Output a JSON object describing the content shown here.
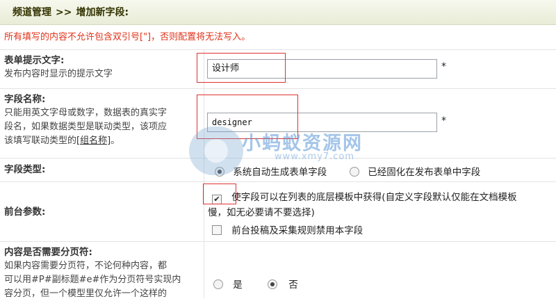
{
  "breadcrumb": {
    "section": "频道管理",
    "separator": ">>",
    "page": "增加新字段:"
  },
  "warning": "所有填写的内容不允许包含双引号[\"]，否则配置将无法写入。",
  "form": {
    "prompt_text": {
      "label": "表单提示文字:",
      "desc": "发布内容时显示的提示文字",
      "value": "设计师",
      "required_mark": "*"
    },
    "field_name": {
      "label": "字段名称:",
      "desc_lines": [
        "只能用英文字母或数字，数据表的真实字",
        "段名，如果数据类型是联动类型，该项应"
      ],
      "desc_last_prefix": "该填写联动类型的",
      "desc_link": "[组名称]",
      "desc_last_suffix": "。",
      "value": "designer",
      "required_mark": "*"
    },
    "field_type": {
      "label": "字段类型:",
      "options": [
        "系统自动生成表单字段",
        "已经固化在发布表单中字段"
      ],
      "selected": 0
    },
    "frontend_params": {
      "label": "前台参数:",
      "option1_line1": "使字段可以在列表的底层模板中获得(自定义字段默认仅能在文档模板",
      "option1_line2": "慢，如无必要请不要选择)",
      "option1_checked": true,
      "option2": "前台投稿及采集规则禁用本字段",
      "option2_checked": false
    },
    "pagination": {
      "label": "内容是否需要分页符:",
      "desc_lines": [
        "如果内容需要分页符，不论何种内容，都",
        "可以用#P#副标题#e#作为分页符号实现内",
        "容分页，但一个模型里仅允许一个这样的"
      ],
      "options": [
        "是",
        "否"
      ],
      "selected": 1
    }
  },
  "watermark": {
    "text": "小蚂蚁资源网",
    "url": "www.xmy7.com"
  }
}
